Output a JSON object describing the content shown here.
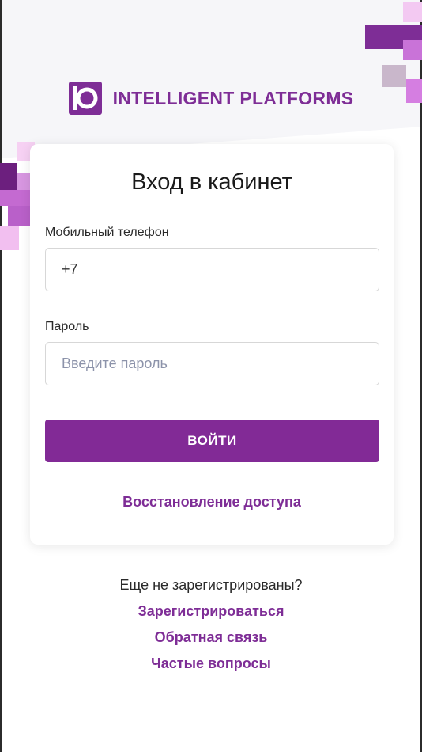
{
  "brand": {
    "name": "INTELLIGENT PLATFORMS",
    "color": "#7e2d96"
  },
  "login": {
    "title": "Вход в кабинет",
    "phone_label": "Мобильный телефон",
    "phone_value": "+7",
    "password_label": "Пароль",
    "password_placeholder": "Введите пароль",
    "submit_label": "ВОЙТИ",
    "restore_link": "Восстановление доступа"
  },
  "footer": {
    "not_registered": "Еще не зарегистрированы?",
    "register_link": "Зарегистрироваться",
    "feedback_link": "Обратная связь",
    "faq_link": "Частые вопросы"
  },
  "colors": {
    "accent": "#822a96",
    "background": "#f6f6f9"
  }
}
